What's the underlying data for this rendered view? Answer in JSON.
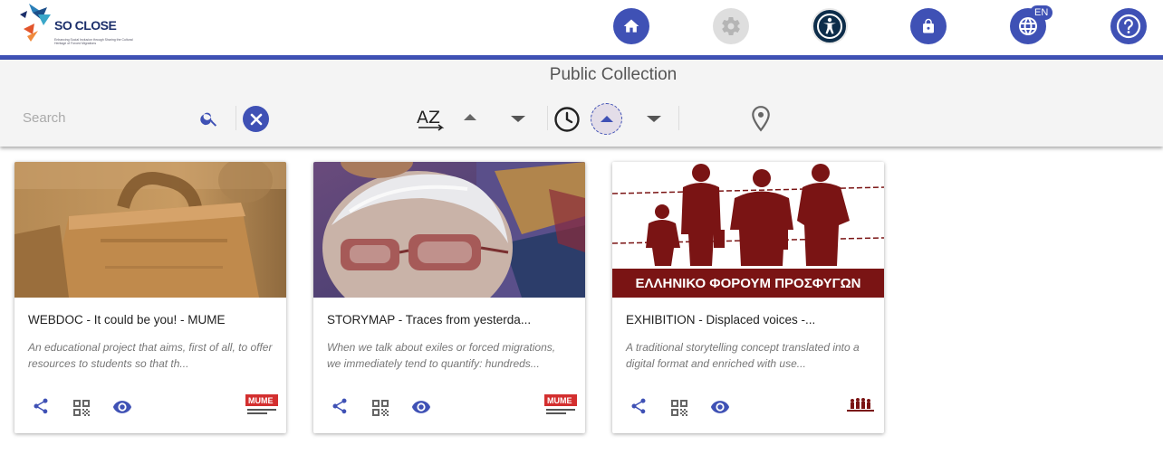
{
  "header": {
    "logo_text": "SO CLOSE",
    "logo_subtitle": "Enhancing Social Inclusion through Sharing the Cultural Heritage of Forced Migrations",
    "lang_badge": "EN"
  },
  "toolbar": {
    "title": "Public Collection",
    "search_placeholder": "Search",
    "search_value": ""
  },
  "cards": [
    {
      "title": "WEBDOC - It could be you! - MUME",
      "description": "An educational project that aims, first of all, to offer resources to students so that th...",
      "logo": "MUME"
    },
    {
      "title": "STORYMAP - Traces from yesterda...",
      "description": "When we talk about exiles or forced migrations, we immediately tend to quantify: hundreds...",
      "logo": "MUME"
    },
    {
      "title": "EXHIBITION - Displaced voices -...",
      "description": "A traditional storytelling concept translated into a digital format and enriched with use...",
      "banner_text": "ΕΛΛΗΝΙΚΟ ΦΟΡΟΥΜ ΠΡΟΣΦΥΓΩΝ"
    }
  ],
  "colors": {
    "primary": "#3f51b5",
    "accessibility": "#0d2d4a",
    "mume_red": "#d32f2f",
    "banner_red": "#7a1414"
  },
  "icons": [
    "home-icon",
    "settings-icon",
    "accessibility-icon",
    "lock-icon",
    "globe-icon",
    "help-icon",
    "search-icon",
    "close-icon",
    "sort-az-icon",
    "clock-icon",
    "location-pin-icon",
    "share-icon",
    "qr-code-icon",
    "eye-icon"
  ]
}
